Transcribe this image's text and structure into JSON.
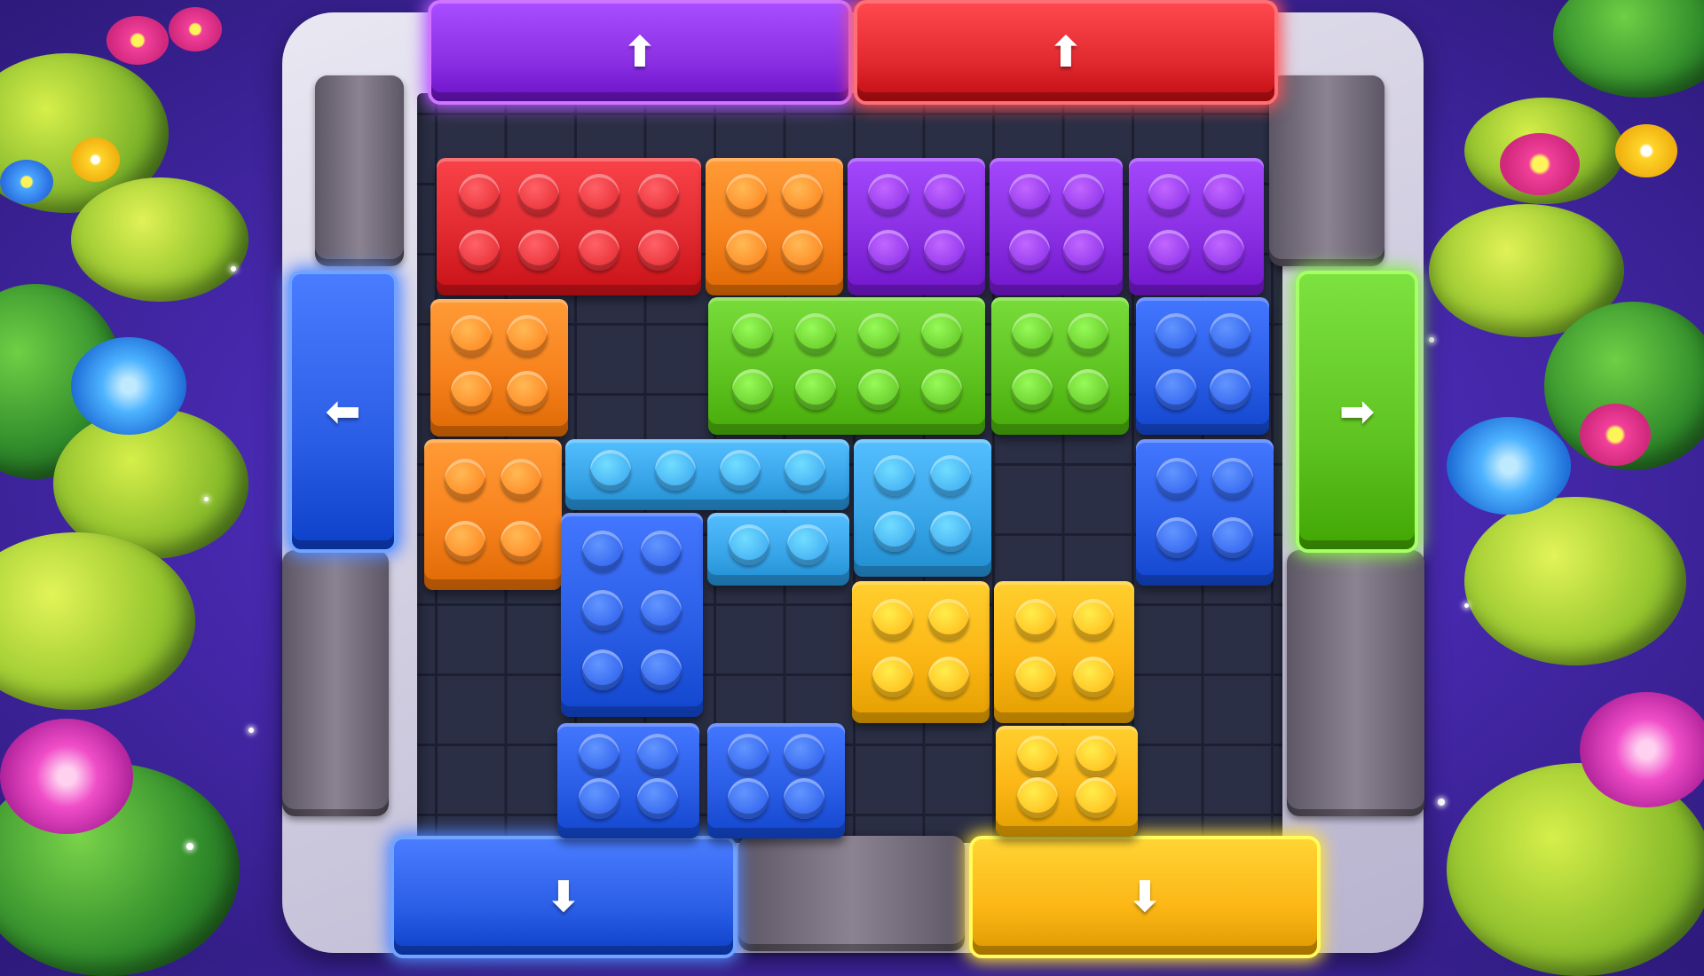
{
  "colors": {
    "red": "#e02a30",
    "orange": "#f7821d",
    "purple": "#8a2fe3",
    "green": "#5fc421",
    "blue": "#2b5ee6",
    "lightblue": "#3aa6ea",
    "yellow": "#fbb615",
    "wall": "#7a7382"
  },
  "exits": [
    {
      "name": "exit-purple-up",
      "color": "purple",
      "direction": "up",
      "glyph": "⬆"
    },
    {
      "name": "exit-red-up",
      "color": "red",
      "direction": "up",
      "glyph": "⬆"
    },
    {
      "name": "exit-blue-left",
      "color": "blue",
      "direction": "left",
      "glyph": "⬅"
    },
    {
      "name": "exit-green-right",
      "color": "green",
      "direction": "right",
      "glyph": "➡"
    },
    {
      "name": "exit-blue-down",
      "color": "blue",
      "direction": "down",
      "glyph": "⬇"
    },
    {
      "name": "exit-yellow-down",
      "color": "yellow",
      "direction": "down",
      "glyph": "⬇"
    }
  ],
  "blocks": [
    {
      "color": "red",
      "cols": 4,
      "rows": 2
    },
    {
      "color": "orange",
      "cols": 2,
      "rows": 2
    },
    {
      "color": "purple",
      "cols": 2,
      "rows": 2
    },
    {
      "color": "purple",
      "cols": 2,
      "rows": 2
    },
    {
      "color": "purple",
      "cols": 2,
      "rows": 2
    },
    {
      "color": "orange",
      "cols": 2,
      "rows": 2
    },
    {
      "color": "green",
      "cols": 4,
      "rows": 2
    },
    {
      "color": "green",
      "cols": 2,
      "rows": 2
    },
    {
      "color": "blue",
      "cols": 2,
      "rows": 2
    },
    {
      "color": "orange",
      "cols": 2,
      "rows": 2
    },
    {
      "color": "lightblue",
      "cols": 4,
      "rows": 1
    },
    {
      "color": "lightblue",
      "cols": 2,
      "rows": 2
    },
    {
      "color": "blue",
      "cols": 2,
      "rows": 2
    },
    {
      "color": "blue",
      "cols": 2,
      "rows": 3
    },
    {
      "color": "lightblue",
      "cols": 2,
      "rows": 1
    },
    {
      "color": "yellow",
      "cols": 2,
      "rows": 2
    },
    {
      "color": "yellow",
      "cols": 2,
      "rows": 2
    },
    {
      "color": "blue",
      "cols": 2,
      "rows": 2
    },
    {
      "color": "blue",
      "cols": 2,
      "rows": 2
    },
    {
      "color": "yellow",
      "cols": 2,
      "rows": 2
    }
  ]
}
